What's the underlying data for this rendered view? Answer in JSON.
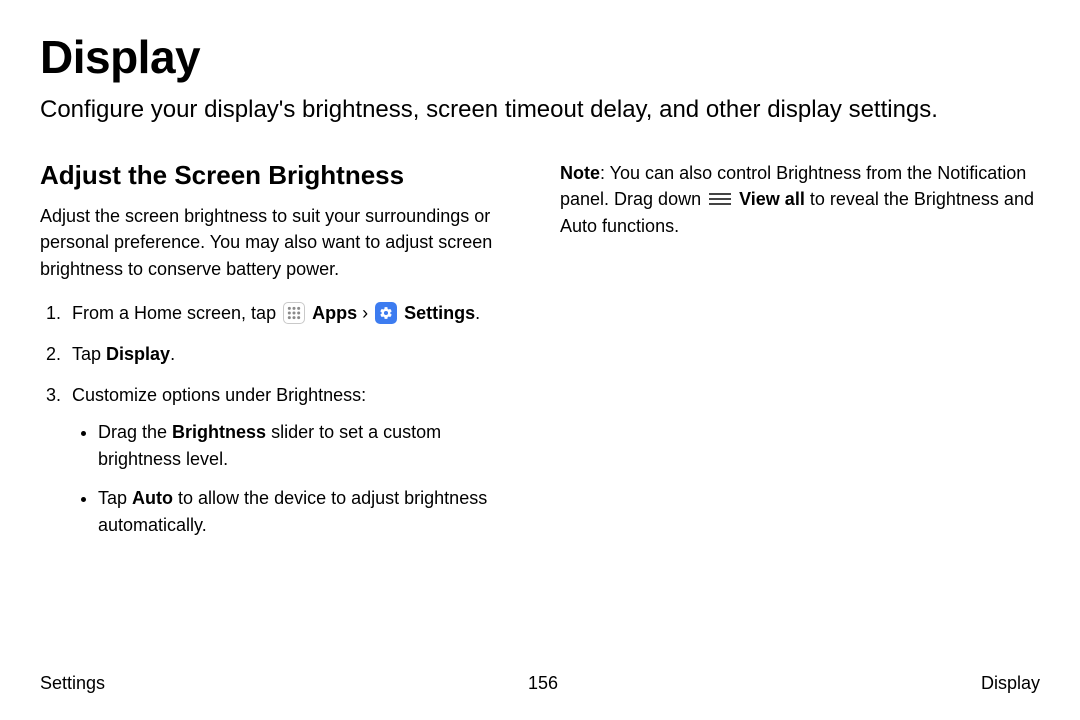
{
  "title": "Display",
  "intro": "Configure your display's brightness, screen timeout delay, and other display settings.",
  "left": {
    "heading": "Adjust the Screen Brightness",
    "desc": "Adjust the screen brightness to suit your surroundings or personal preference. You may also want to adjust screen brightness to conserve battery power.",
    "step1_a": "From a Home screen, tap ",
    "step1_apps": "Apps",
    "step1_sep": " › ",
    "step1_settings": "Settings",
    "step1_end": ".",
    "step2_a": "Tap ",
    "step2_b": "Display",
    "step2_end": ".",
    "step3": "Customize options under Brightness:",
    "b1_a": "Drag the ",
    "b1_b": "Brightness",
    "b1_c": " slider to set a custom brightness level.",
    "b2_a": "Tap ",
    "b2_b": "Auto",
    "b2_c": " to allow the device to adjust brightness automatically."
  },
  "right": {
    "note_a": "Note",
    "note_b": ": You can also control Brightness from the Notification panel. Drag down ",
    "note_viewall": "View all",
    "note_c": " to reveal the Brightness and Auto functions."
  },
  "footer": {
    "left": "Settings",
    "center": "156",
    "right": "Display"
  }
}
